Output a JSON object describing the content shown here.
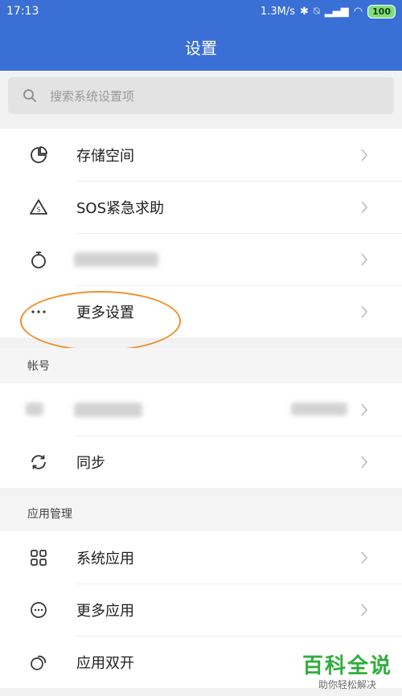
{
  "status_bar": {
    "time": "17:13",
    "net_speed": "1.3M/s",
    "battery": "100"
  },
  "title": "设置",
  "search": {
    "placeholder": "搜索系统设置项"
  },
  "section1": {
    "items": [
      {
        "label": "存储空间",
        "icon": "pie-chart-icon"
      },
      {
        "label": "SOS紧急求助",
        "icon": "sos-warning-icon"
      },
      {
        "label": "",
        "icon": "stopwatch-icon"
      },
      {
        "label": "更多设置",
        "icon": "more-horizontal-icon"
      }
    ]
  },
  "account_section": {
    "header": "帐号",
    "items": [
      {
        "label": "",
        "icon": "account-icon"
      },
      {
        "label": "同步",
        "icon": "sync-icon"
      }
    ]
  },
  "apps_section": {
    "header": "应用管理",
    "items": [
      {
        "label": "系统应用",
        "icon": "grid-icon"
      },
      {
        "label": "更多应用",
        "icon": "more-circle-icon"
      },
      {
        "label": "应用双开",
        "icon": "dual-app-icon"
      }
    ]
  },
  "watermark": {
    "title": "百科全说",
    "subtitle": "助你轻松解决"
  },
  "colors": {
    "header_blue": "#3a6fd6",
    "highlight_oval": "#f08f2b",
    "watermark_green": "#2fae3c"
  }
}
